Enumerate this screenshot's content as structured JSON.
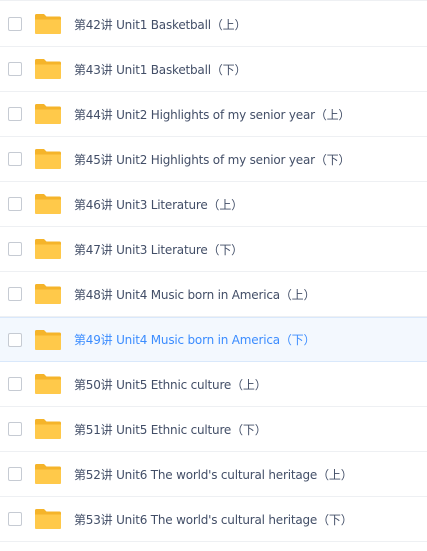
{
  "files": {
    "items": [
      {
        "name": "第42讲 Unit1 Basketball（上）",
        "icon": "folder-icon",
        "selected": false
      },
      {
        "name": "第43讲 Unit1 Basketball（下）",
        "icon": "folder-icon",
        "selected": false
      },
      {
        "name": "第44讲 Unit2 Highlights of my senior year（上）",
        "icon": "folder-icon",
        "selected": false
      },
      {
        "name": "第45讲 Unit2 Highlights of my senior year（下）",
        "icon": "folder-icon",
        "selected": false
      },
      {
        "name": "第46讲 Unit3 Literature（上）",
        "icon": "folder-icon",
        "selected": false
      },
      {
        "name": "第47讲 Unit3 Literature（下）",
        "icon": "folder-icon",
        "selected": false
      },
      {
        "name": "第48讲 Unit4 Music born in America（上）",
        "icon": "folder-icon",
        "selected": false
      },
      {
        "name": "第49讲 Unit4 Music born in America（下）",
        "icon": "folder-icon",
        "selected": true
      },
      {
        "name": "第50讲 Unit5 Ethnic culture（上）",
        "icon": "folder-icon",
        "selected": false
      },
      {
        "name": "第51讲 Unit5 Ethnic culture（下）",
        "icon": "folder-icon",
        "selected": false
      },
      {
        "name": "第52讲 Unit6 The world's cultural heritage（上）",
        "icon": "folder-icon",
        "selected": false
      },
      {
        "name": "第53讲 Unit6 The world's cultural heritage（下）",
        "icon": "folder-icon",
        "selected": false
      }
    ]
  },
  "colors": {
    "folder": "#ffc94a",
    "folder_tab": "#f5b42a",
    "text": "#424e67",
    "selected_text": "#3b8cff",
    "selected_bg": "#f3f8fe"
  }
}
